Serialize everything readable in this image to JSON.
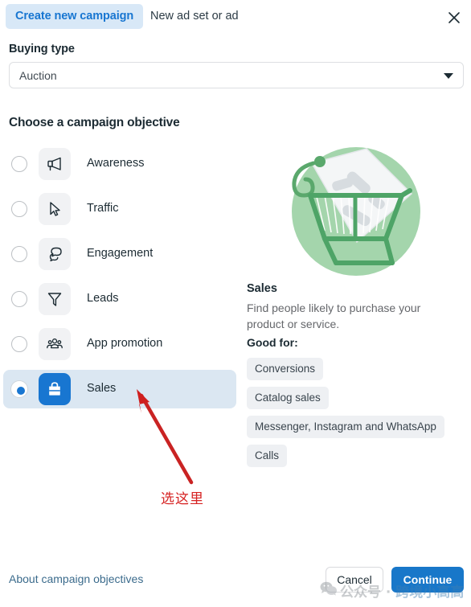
{
  "header": {
    "tab_active": "Create new campaign",
    "tab_inactive": "New ad set or ad",
    "close_icon": "close-icon"
  },
  "buying_type": {
    "label": "Buying type",
    "value": "Auction",
    "caret_icon": "chevron-down-icon"
  },
  "objective": {
    "title": "Choose a campaign objective",
    "items": [
      {
        "label": "Awareness",
        "icon": "megaphone-icon",
        "selected": false
      },
      {
        "label": "Traffic",
        "icon": "cursor-arrow-icon",
        "selected": false
      },
      {
        "label": "Engagement",
        "icon": "chat-bubbles-icon",
        "selected": false
      },
      {
        "label": "Leads",
        "icon": "funnel-icon",
        "selected": false
      },
      {
        "label": "App promotion",
        "icon": "people-group-icon",
        "selected": false
      },
      {
        "label": "Sales",
        "icon": "shopping-bag-icon",
        "selected": true
      }
    ]
  },
  "detail": {
    "illustration": "shopping-cart-price-tag-illustration",
    "title": "Sales",
    "description": "Find people likely to purchase your product or service.",
    "good_for_label": "Good for:",
    "tags": [
      "Conversions",
      "Catalog sales",
      "Messenger, Instagram and WhatsApp",
      "Calls"
    ]
  },
  "annotation": {
    "text": "选这里",
    "color": "#d62222",
    "arrow_icon": "red-arrow-icon"
  },
  "footer": {
    "link": "About campaign objectives",
    "cancel": "Cancel",
    "continue": "Continue"
  },
  "watermark": {
    "prefix": "公众号 · ",
    "name": "跨境小高高",
    "icon": "wechat-icon"
  },
  "colors": {
    "accent_blue": "#1876d1",
    "tab_bg": "#d8e8f7",
    "selected_row_bg": "#dbe7f2",
    "tag_bg": "#eef0f3",
    "illustration_green": "#7ec98a",
    "annotation_red": "#d62222"
  }
}
